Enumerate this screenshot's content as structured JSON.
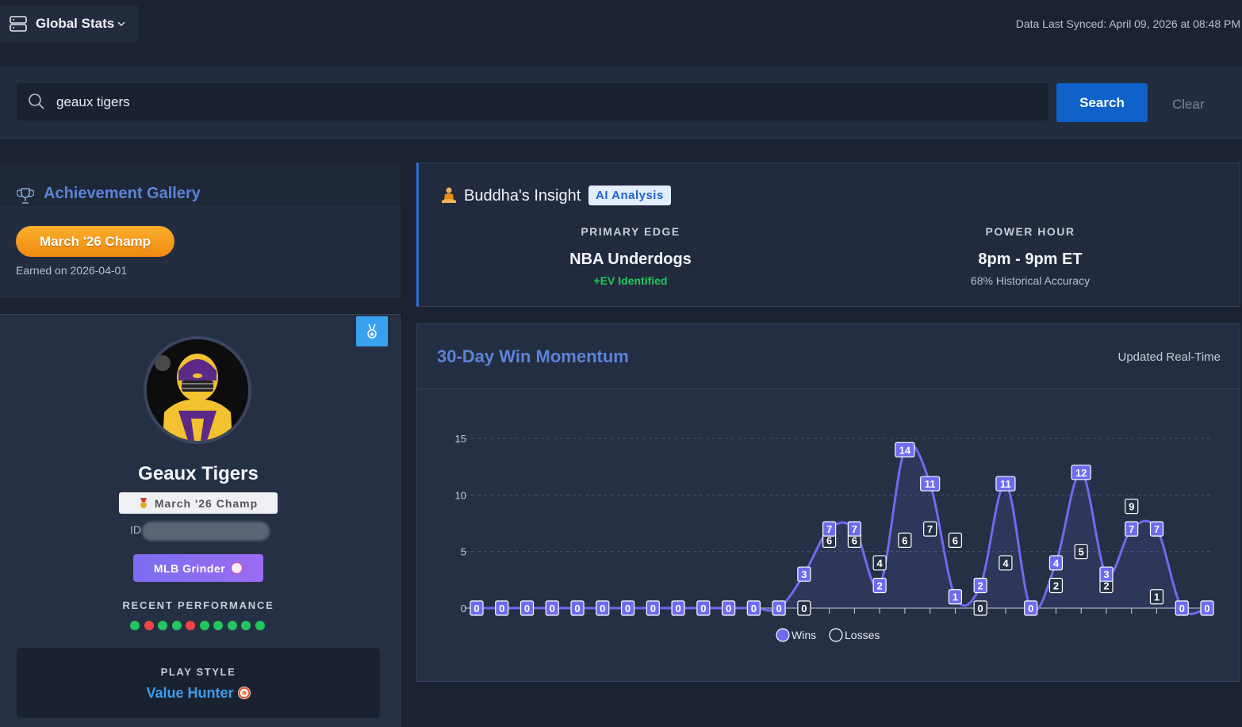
{
  "header": {
    "global_stats_label": "Global Stats",
    "synced_text": "Data Last Synced: April 09, 2026 at 08:48 PM"
  },
  "search": {
    "value": "geaux tigers",
    "search_label": "Search",
    "clear_label": "Clear"
  },
  "achievements": {
    "title": "Achievement Gallery",
    "badge_label": "March '26 Champ",
    "earned_text": "Earned on 2026-04-01"
  },
  "profile": {
    "name": "Geaux Tigers",
    "champ_tag": "March '26 Champ",
    "id_label": "ID",
    "grinder_label": "MLB Grinder",
    "recent_label": "RECENT PERFORMANCE",
    "recent_results": [
      "W",
      "L",
      "W",
      "W",
      "L",
      "W",
      "W",
      "W",
      "W",
      "W"
    ],
    "colors": {
      "win": "#22c55e",
      "loss": "#ef4444"
    },
    "play_style_label": "PLAY STYLE",
    "play_style_value": "Value Hunter"
  },
  "insight": {
    "title": "Buddha's Insight",
    "badge": "AI Analysis",
    "primary_edge_label": "PRIMARY EDGE",
    "primary_edge_value": "NBA Underdogs",
    "primary_edge_sub": "+EV Identified",
    "power_hour_label": "POWER HOUR",
    "power_hour_value": "8pm - 9pm ET",
    "power_hour_sub": "68% Historical Accuracy"
  },
  "chart_data": {
    "type": "line",
    "title": "30-Day Win Momentum",
    "subtitle": "Updated Real-Time",
    "ylim": [
      0,
      15
    ],
    "yticks": [
      0,
      5,
      10,
      15
    ],
    "grid": true,
    "legend_position": "bottom-center",
    "series": [
      {
        "name": "Wins",
        "color": "#6f6af0",
        "values": [
          0,
          0,
          0,
          0,
          0,
          0,
          0,
          0,
          0,
          0,
          0,
          0,
          0,
          3,
          7,
          7,
          2,
          14,
          11,
          1,
          2,
          11,
          0,
          4,
          12,
          3,
          7,
          7,
          0,
          0
        ]
      },
      {
        "name": "Losses",
        "color": "#ffffff",
        "values": [
          0,
          0,
          0,
          0,
          0,
          0,
          0,
          0,
          0,
          0,
          0,
          0,
          0,
          0,
          6,
          6,
          4,
          6,
          7,
          6,
          0,
          4,
          0,
          2,
          5,
          2,
          9,
          1,
          0,
          0
        ]
      }
    ]
  }
}
